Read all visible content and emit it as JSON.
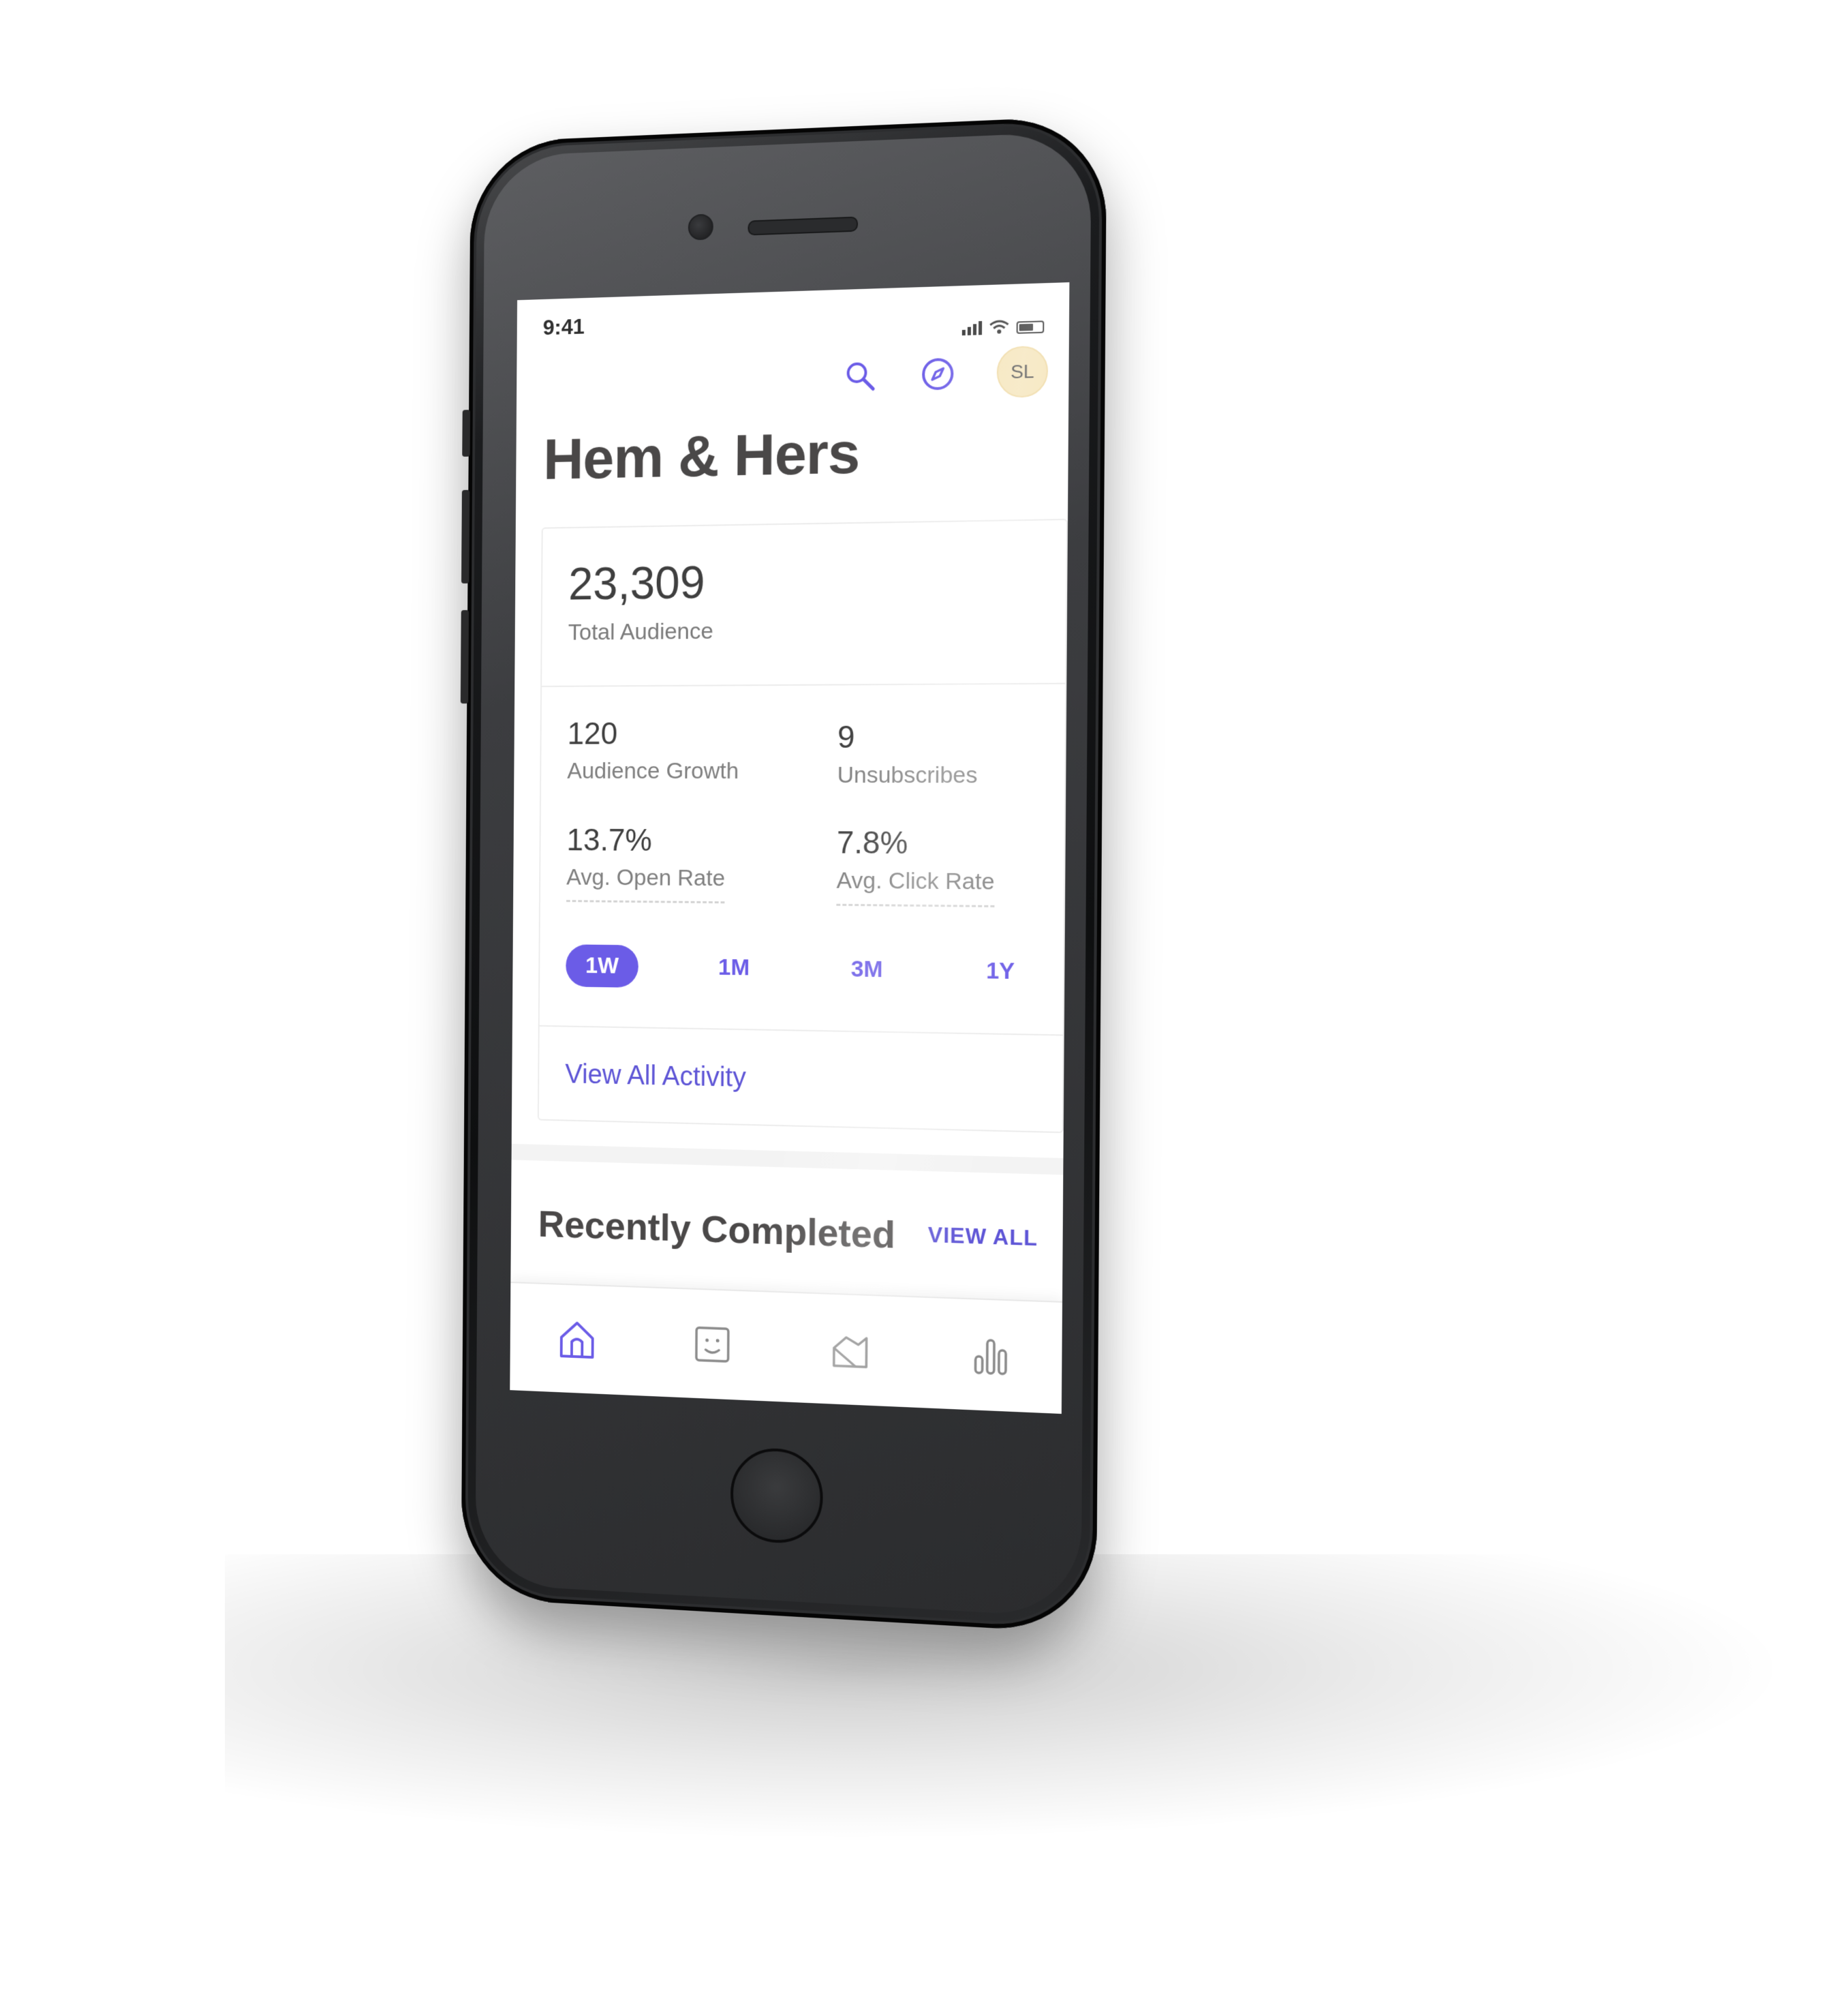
{
  "status_bar": {
    "time": "9:41"
  },
  "header": {
    "icons": [
      "search-icon",
      "compass-icon"
    ],
    "avatar_initials": "SL",
    "title": "Hem & Hers"
  },
  "summary_card": {
    "total": {
      "value": "23,309",
      "label": "Total Audience"
    },
    "stats": [
      {
        "value": "120",
        "label": "Audience Growth"
      },
      {
        "value": "9",
        "label": "Unsubscribes"
      },
      {
        "value": "13.7%",
        "label": "Avg. Open Rate"
      },
      {
        "value": "7.8%",
        "label": "Avg. Click Rate"
      }
    ],
    "ranges": [
      "1W",
      "1M",
      "3M",
      "1Y"
    ],
    "active_range": "1W",
    "view_activity_label": "View All Activity"
  },
  "recent": {
    "title": "Recently Completed",
    "view_all_label": "VIEW ALL"
  },
  "tab_bar": {
    "items": [
      "home-icon",
      "audience-icon",
      "campaigns-icon",
      "reports-icon"
    ],
    "active": "home-icon"
  },
  "colors": {
    "accent": "#6b5ce7",
    "avatar_bg": "#f5e4b8",
    "text_dark": "#4a4848",
    "text_muted": "#7a7a7a"
  }
}
